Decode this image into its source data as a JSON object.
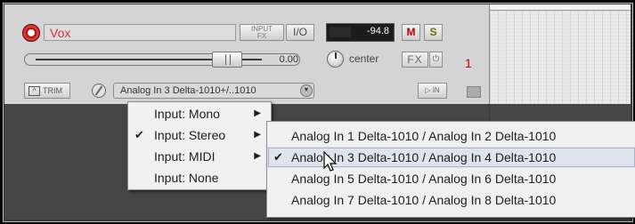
{
  "track": {
    "name": "Vox",
    "input_fx_label": "INPUT\nFX",
    "io_label": "I/O",
    "meter_value": "-94.8",
    "mute_label": "M",
    "solo_label": "S",
    "volume_value": "0.00",
    "pan_value": "center",
    "fx_label": "FX",
    "phase_label": "φ",
    "track_number": "1",
    "trim_label": "TRIM",
    "input_selection": "Analog In 3 Delta-1010+/..1010",
    "monitor_label": "IN",
    "colors": {
      "name_text": "#d23535",
      "record_arm": "#b81010",
      "track_number": "#c40000"
    }
  },
  "input_menu": {
    "items": [
      {
        "label": "Input: Mono",
        "checked": false,
        "has_submenu": true
      },
      {
        "label": "Input: Stereo",
        "checked": true,
        "has_submenu": true
      },
      {
        "label": "Input: MIDI",
        "checked": false,
        "has_submenu": true
      },
      {
        "label": "Input: None",
        "checked": false,
        "has_submenu": false
      }
    ]
  },
  "stereo_submenu": {
    "items": [
      {
        "label": "Analog In 1 Delta-1010 / Analog In 2 Delta-1010",
        "checked": false,
        "highlighted": false
      },
      {
        "label": "Analog In 3 Delta-1010 / Analog In 4 Delta-1010",
        "checked": true,
        "highlighted": true
      },
      {
        "label": "Analog In 5 Delta-1010 / Analog In 6 Delta-1010",
        "checked": false,
        "highlighted": false
      },
      {
        "label": "Analog In 7 Delta-1010 / Analog In 8 Delta-1010",
        "checked": false,
        "highlighted": false
      }
    ]
  },
  "icons": {
    "check": "✔",
    "submenu_arrow": "▶",
    "dropdown": "▼"
  }
}
